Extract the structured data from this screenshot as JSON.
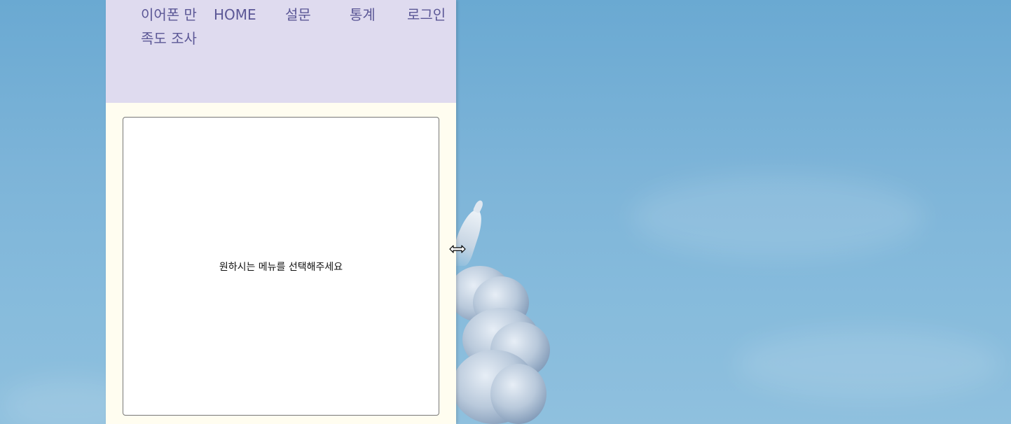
{
  "nav": {
    "title": "이어폰 만족도 조사",
    "home": "HOME",
    "survey": "설문",
    "stats": "통계",
    "login": "로그인"
  },
  "main": {
    "prompt": "원하시는 메뉴를 선택해주세요"
  },
  "cursor": {
    "icon": "horizontal-resize-cursor-icon"
  },
  "colors": {
    "header_bg": "#dfdbef",
    "nav_text": "#5b5796",
    "page_bg": "#fffdf0",
    "desktop_sky": "#7db4d8"
  }
}
